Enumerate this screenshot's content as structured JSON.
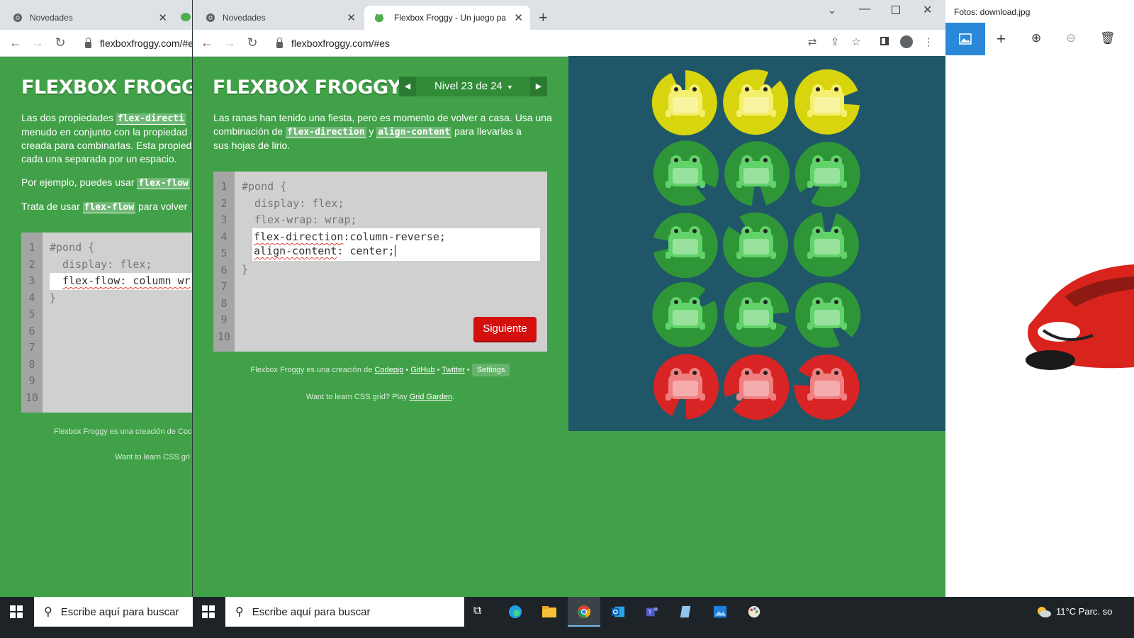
{
  "back_window": {
    "tab_label": "Novedades",
    "url": "flexboxfroggy.com/#es",
    "logo": "FLEXBOX FROGGY",
    "paragraph1_a": "Las dos propiedades ",
    "paragraph1_code": "flex-directi",
    "paragraph1_b": "menudo en conjunto con la propiedad",
    "paragraph1_c": "creada para combinarlas. Esta propied",
    "paragraph1_d": "cada una separada por un espacio.",
    "paragraph2_a": "Por ejemplo, puedes usar ",
    "paragraph2_code": "flex-flow",
    "paragraph3_a": "Trata de usar ",
    "paragraph3_code": "flex-flow",
    "paragraph3_b": " para volver",
    "line_numbers": [
      "1",
      "2",
      "3",
      "4",
      "5",
      "6",
      "7",
      "8",
      "9",
      "10"
    ],
    "code_line1": "#pond {",
    "code_line2": "  display: flex;",
    "input_line": "flex-flow: column wr",
    "code_line4": "}",
    "footer1": "Flexbox Froggy es una creación de Coc",
    "footer2": "Want to learn CSS gri"
  },
  "front_window": {
    "tab1_label": "Novedades",
    "tab2_label": "Flexbox Froggy - Un juego para a",
    "new_tab": "+",
    "url": "flexboxfroggy.com/#es",
    "logo": "FLEXBOX FROGGY",
    "level_label": "Nivel 23 de 24",
    "instructions_a": "Las ranas han tenido una fiesta, pero es momento de volver a casa. Usa una",
    "instructions_b1": "combinación de ",
    "instructions_code1": "flex-direction",
    "instructions_b2": " y ",
    "instructions_code2": "align-content",
    "instructions_b3": " para llevarlas a",
    "instructions_c": "sus hojas de lirio.",
    "line_numbers": [
      "1",
      "2",
      "3",
      "4",
      "5",
      "6",
      "7",
      "8",
      "9",
      "10"
    ],
    "code_line1": "#pond {",
    "code_line2": "  display: flex;",
    "code_line3": "  flex-wrap: wrap;",
    "input_line1_prop": "flex-direction",
    "input_line1_rest": ":column-reverse;",
    "input_line2_prop": "align-content",
    "input_line2_rest": ": center;",
    "code_line6": "}",
    "next_button": "Siguiente",
    "footer_text": "Flexbox Froggy es una creación de ",
    "footer_codepip": "Codepip",
    "footer_sep": " • ",
    "footer_github": "GitHub",
    "footer_twitter": "Twitter",
    "footer_settings": "Settings",
    "footer2_text": "Want to learn CSS grid? Play ",
    "footer2_link": "Grid Garden",
    "footer2_end": "."
  },
  "pond": {
    "rows": [
      [
        "yellow",
        "yellow",
        "yellow"
      ],
      [
        "green",
        "green",
        "green"
      ],
      [
        "green",
        "green",
        "green"
      ],
      [
        "green",
        "green",
        "green"
      ],
      [
        "red",
        "red",
        "red"
      ]
    ],
    "colors": {
      "yellow_pad": "#d8d40e",
      "yellow_frog": "#f4ef6e",
      "green_pad": "#2f9638",
      "green_frog": "#62d36a",
      "red_pad": "#d82424",
      "red_frog": "#f08080"
    }
  },
  "photos_app": {
    "title": "Fotos: download.jpg"
  },
  "taskbar": {
    "search_placeholder": "Escribe aquí para buscar",
    "weather": "11°C  Parc. so"
  },
  "colors": {
    "page_green": "#41a148",
    "pond_blue": "#1f5768",
    "next_red": "#d50e0e"
  }
}
